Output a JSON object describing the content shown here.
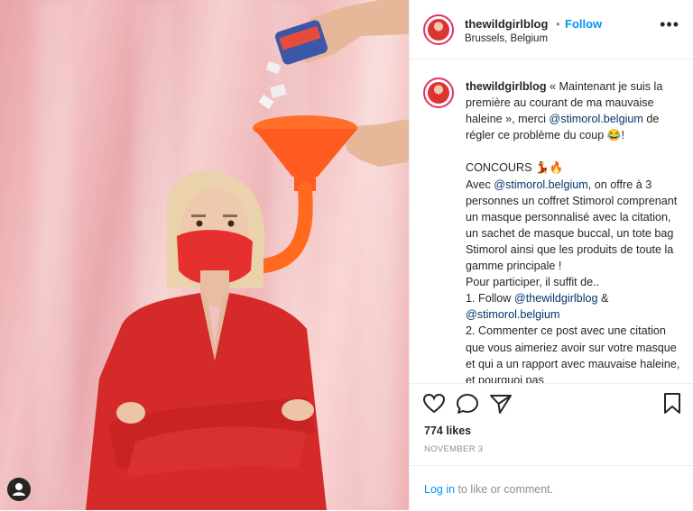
{
  "colors": {
    "accent": "#0095f6",
    "link": "#00376b",
    "jacket": "#d42a2a",
    "background": "#f3c2c3"
  },
  "header": {
    "username": "thewildgirlblog",
    "separator": "•",
    "follow_label": "Follow",
    "location": "Brussels, Belgium",
    "more_icon": "more-horizontal-icon"
  },
  "caption": {
    "username": "thewildgirlblog",
    "p1_a": "« Maintenant je suis la première au courant de ma mauvaise haleine », merci ",
    "p1_mention": "@stimorol.belgium",
    "p1_b": " de régler ce problème du coup 😂!",
    "concours": "CONCOURS 💃🔥",
    "p2_a": "Avec ",
    "p2_mention": "@stimorol.belgium",
    "p2_b": ", on offre à 3 personnes un coffret Stimorol comprenant un masque personnalisé avec la citation, un sachet de masque buccal, un tote bag Stimorol ainsi que les produits de toute la gamme principale !",
    "p3": "Pour participer, il suffit de..",
    "p4_a": "1. Follow ",
    "p4_mention1": "@thewildgirlblog",
    "p4_b": " & ",
    "p4_mention2": "@stimorol.belgium",
    "p5": "2. Commenter ce post avec une citation que vous aimeriez avoir sur votre masque et qui a un rapport avec",
    "p6": "mauvaise haleine, et pourquoi pas"
  },
  "actions": {
    "like_icon": "heart-icon",
    "comment_icon": "comment-icon",
    "share_icon": "share-icon",
    "save_icon": "bookmark-icon",
    "likes": "774 likes",
    "date": "NOVEMBER 3"
  },
  "login": {
    "link": "Log in",
    "rest": " to like or comment."
  },
  "photo": {
    "tag_icon": "user-tag-icon"
  }
}
